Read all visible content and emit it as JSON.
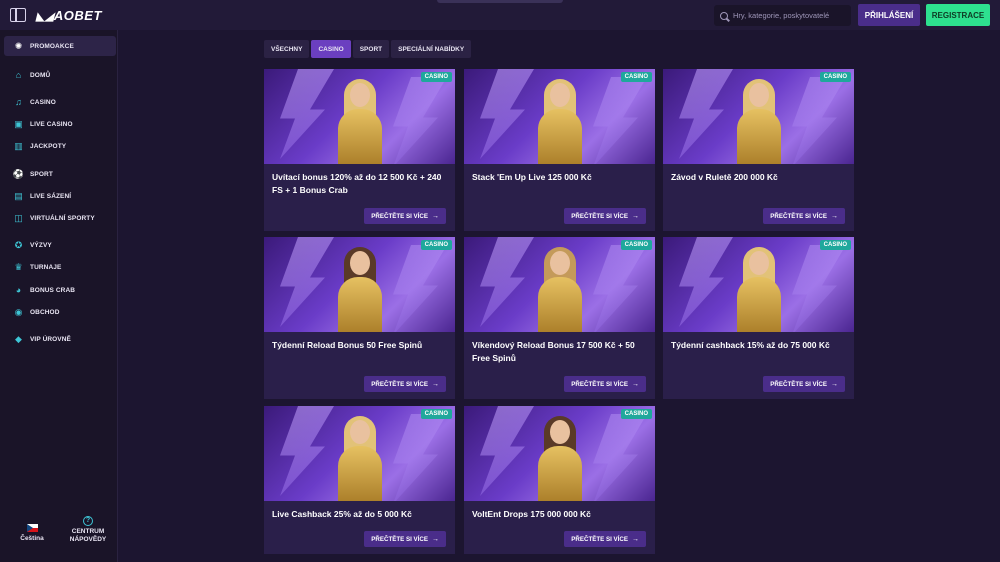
{
  "header": {
    "logo_text": "AOBET",
    "search_placeholder": "Hry, kategorie, poskytovatelé",
    "login_label": "PŘIHLÁŠENÍ",
    "register_label": "REGISTRACE"
  },
  "sidebar": {
    "promo_label": "PROMOAKCE",
    "items": [
      {
        "label": "DOMŮ",
        "icon": "home-icon"
      },
      {
        "label": "CASINO",
        "icon": "music-note-icon"
      },
      {
        "label": "LIVE CASINO",
        "icon": "live-casino-icon"
      },
      {
        "label": "JACKPOTY",
        "icon": "jackpot-icon"
      },
      {
        "label": "SPORT",
        "icon": "sport-icon"
      },
      {
        "label": "LIVE SÁZENÍ",
        "icon": "live-betting-icon"
      },
      {
        "label": "VIRTUÁLNÍ SPORTY",
        "icon": "virtual-sports-icon"
      },
      {
        "label": "VÝZVY",
        "icon": "medal-icon"
      },
      {
        "label": "TURNAJE",
        "icon": "trophy-icon"
      },
      {
        "label": "BONUS CRAB",
        "icon": "crab-icon"
      },
      {
        "label": "OBCHOD",
        "icon": "shop-icon"
      },
      {
        "label": "VIP ÚROVNĚ",
        "icon": "diamond-icon"
      }
    ],
    "language_label": "Čeština",
    "help_label_line1": "CENTRUM",
    "help_label_line2": "NÁPOVĚDY"
  },
  "tabs": [
    {
      "label": "VŠECHNY",
      "active": false
    },
    {
      "label": "CASINO",
      "active": true
    },
    {
      "label": "SPORT",
      "active": false
    },
    {
      "label": "SPECIÁLNÍ NABÍDKY",
      "active": false
    }
  ],
  "colors": {
    "accent_green": "#2ee08f",
    "accent_purple": "#6b3fc0",
    "badge_teal": "#1fa89c",
    "background": "#1c1530"
  },
  "cards": [
    {
      "badge": "CASINO",
      "title": "Uvítací bonus 120% až do 12 500 Kč + 240 FS + 1 Bonus Crab",
      "button": "PŘEČTĚTE SI VÍCE",
      "hair": "#e2c278"
    },
    {
      "badge": "CASINO",
      "title": "Stack 'Em Up Live 125 000 Kč",
      "button": "PŘEČTĚTE SI VÍCE",
      "hair": "#e2c278"
    },
    {
      "badge": "CASINO",
      "title": "Závod v Ruletě 200 000 Kč",
      "button": "PŘEČTĚTE SI VÍCE",
      "hair": "#e2c278"
    },
    {
      "badge": "CASINO",
      "title": "Týdenní Reload Bonus 50 Free Spinů",
      "button": "PŘEČTĚTE SI VÍCE",
      "hair": "#5a3a28"
    },
    {
      "badge": "CASINO",
      "title": "Víkendový Reload Bonus 17 500 Kč + 50 Free Spinů",
      "button": "PŘEČTĚTE SI VÍCE",
      "hair": "#c49a5a"
    },
    {
      "badge": "CASINO",
      "title": "Týdenní cashback 15% až do 75 000 Kč",
      "button": "PŘEČTĚTE SI VÍCE",
      "hair": "#e2c278"
    },
    {
      "badge": "CASINO",
      "title": "Live Cashback 25% až do 5 000 Kč",
      "button": "PŘEČTĚTE SI VÍCE",
      "hair": "#e2c278"
    },
    {
      "badge": "CASINO",
      "title": "VoltEnt Drops 175 000 000 Kč",
      "button": "PŘEČTĚTE SI VÍCE",
      "hair": "#5a3a28"
    }
  ]
}
